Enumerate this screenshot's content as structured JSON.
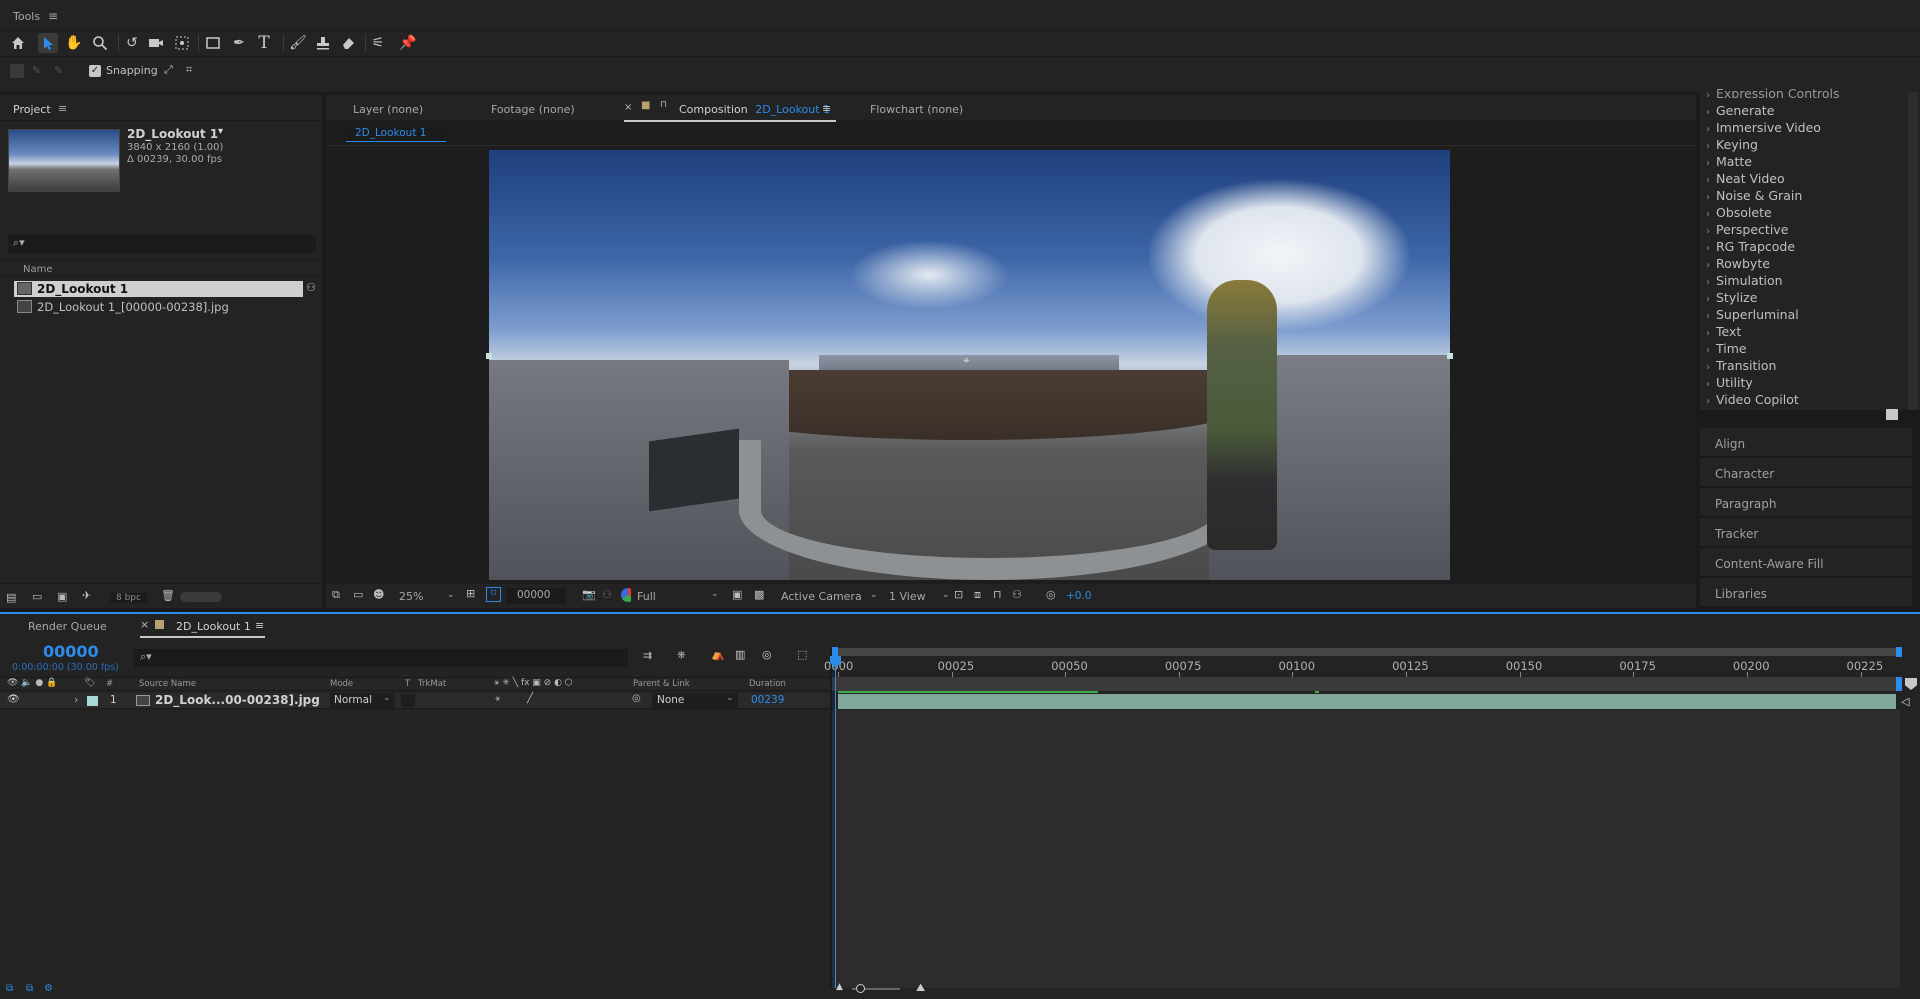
{
  "tools": {
    "title": "Tools",
    "snapping_label": "Snapping"
  },
  "project": {
    "tab": "Project",
    "comp_name": "2D_Lookout 1",
    "comp_size": "3840 x 2160 (1.00)",
    "comp_duration": "Δ 00239, 30.00 fps",
    "search_placeholder": "",
    "column_name": "Name",
    "items": [
      {
        "name": "2D_Lookout 1"
      },
      {
        "name": "2D_Lookout 1_[00000-00238].jpg"
      }
    ],
    "bpc": "8 bpc"
  },
  "viewer": {
    "tabs": [
      {
        "label": "Layer  (none)"
      },
      {
        "label": "Footage  (none)"
      },
      {
        "label": "Composition",
        "target": "2D_Lookout 1"
      },
      {
        "label": "Flowchart  (none)"
      }
    ],
    "active_comp_chip": "2D_Lookout 1",
    "zoom": "25%",
    "timecode": "00000",
    "resolution": "Full",
    "camera": "Active Camera",
    "views": "1 View",
    "exposure": "+0.0"
  },
  "effects": {
    "cut_item": "Expression Controls",
    "items": [
      "Generate",
      "Immersive Video",
      "Keying",
      "Matte",
      "Neat Video",
      "Noise & Grain",
      "Obsolete",
      "Perspective",
      "RG Trapcode",
      "Rowbyte",
      "Simulation",
      "Stylize",
      "Superluminal",
      "Text",
      "Time",
      "Transition",
      "Utility",
      "Video Copilot"
    ]
  },
  "right_panels": [
    "Align",
    "Character",
    "Paragraph",
    "Tracker",
    "Content-Aware Fill",
    "Libraries"
  ],
  "timeline": {
    "tabs": [
      {
        "label": "Render Queue"
      },
      {
        "label": "2D_Lookout 1"
      }
    ],
    "timecode": "00000",
    "timecode_sub": "0:00:00:00 (30.00 fps)",
    "columns": {
      "num": "#",
      "source": "Source Name",
      "mode": "Mode",
      "t": "T",
      "trkmat": "TrkMat",
      "parent": "Parent & Link",
      "duration": "Duration"
    },
    "layer": {
      "num": "1",
      "name": "2D_Look...00-00238].jpg",
      "mode": "Normal",
      "parent": "None",
      "duration": "00239"
    },
    "ruler": [
      "0000",
      "00025",
      "00050",
      "00075",
      "00100",
      "00125",
      "00150",
      "00175",
      "00200",
      "00225"
    ]
  },
  "colors": {
    "accent": "#2d8ceb",
    "layer_bar": "#7fa89a",
    "work_area": "#3fae4d",
    "label_color": "#a6d8d8"
  }
}
